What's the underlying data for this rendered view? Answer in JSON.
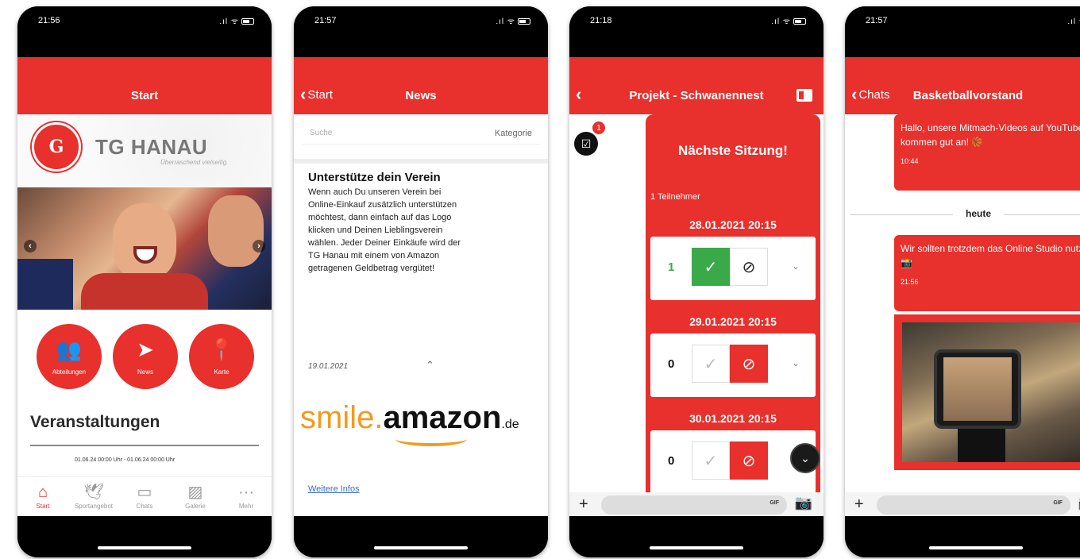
{
  "phones": [
    {
      "status_time": "21:56",
      "nav_title": "Start",
      "brand": "TG HANAU",
      "tagline": "Überraschend vielseitig.",
      "circles": [
        {
          "label": "Abteilungen",
          "icon": "people-icon"
        },
        {
          "label": "News",
          "icon": "send-icon"
        },
        {
          "label": "Karte",
          "icon": "map-pin-icon"
        }
      ],
      "events_title": "Veranstaltungen",
      "event_date": "01.06.24 00:00 Uhr - 01.06.24 00:00 Uhr",
      "tabs": [
        {
          "label": "Start",
          "icon": "home-icon",
          "active": true
        },
        {
          "label": "Sportangebot",
          "icon": "bird-icon",
          "active": false
        },
        {
          "label": "Chats",
          "icon": "chat-icon",
          "active": false
        },
        {
          "label": "Galerie",
          "icon": "gallery-icon",
          "active": false
        },
        {
          "label": "Mehr",
          "icon": "more-icon",
          "active": false
        }
      ]
    },
    {
      "status_time": "21:57",
      "nav_title": "News",
      "back_label": "Start",
      "search_placeholder": "Suche",
      "category_label": "Kategorie",
      "article_title": "Unterstütze dein Verein",
      "article_body": "Wenn auch Du unseren Verein bei Online-Einkauf zusätzlich unterstützen möchtest, dann einfach auf das Logo klicken und Deinen Lieblingsverein wählen. Jeder Deiner Einkäufe wird der TG Hanau mit einem von Amazon getragenen Geldbetrag vergütet!",
      "article_date": "19.01.2021",
      "logo_smile": "smile",
      "logo_amazon": "amazon",
      "logo_de": ".de",
      "more_link": "Weitere Infos"
    },
    {
      "status_time": "21:18",
      "nav_title": "Projekt - Schwanennest",
      "badge_count": "1",
      "card_title": "Nächste Sitzung!",
      "participants": "1 Teilnehmer",
      "slots": [
        {
          "date": "28.01.2021 20:15",
          "count": "1",
          "yes": true,
          "no": false
        },
        {
          "date": "29.01.2021 20:15",
          "count": "0",
          "yes": false,
          "no": true
        },
        {
          "date": "30.01.2021 20:15",
          "count": "0",
          "yes": false,
          "no": true
        }
      ],
      "gif_label": "GIF"
    },
    {
      "status_time": "21:57",
      "nav_title": "Basketballvorstand",
      "back_label": "Chats",
      "messages": [
        {
          "text": "Hallo, unsere Mitmach-Videos auf YouTube kommen gut an! 🏀",
          "time": "10:44"
        },
        {
          "text": "Wir sollten trotzdem das Online Studio nutzen! 📸",
          "time": "21:56"
        }
      ],
      "day_separator": "heute",
      "gif_label": "GIF"
    }
  ]
}
